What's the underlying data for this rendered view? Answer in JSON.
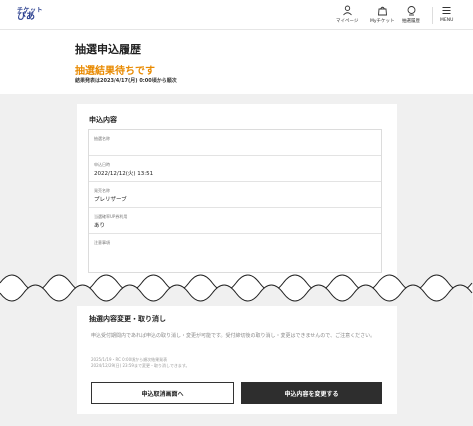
{
  "header": {
    "logo_line1": "チケット",
    "logo_line2": "ぴあ",
    "nav": [
      {
        "label": "マイページ",
        "icon": "person-icon"
      },
      {
        "label": "Myチケット",
        "icon": "ticket-bag-icon"
      },
      {
        "label": "抽選履歴",
        "icon": "search-history-icon"
      },
      {
        "label": "MENU",
        "icon": "menu-icon"
      }
    ]
  },
  "page": {
    "title": "抽選申込履歴",
    "status": "抽選結果待ちです",
    "announce_note": "結果発表は2023/4/17(月) 0:00頃から順次"
  },
  "details": {
    "section_title": "申込内容",
    "rows": [
      {
        "label": "抽選名称",
        "value": ""
      },
      {
        "label": "申込日時",
        "value": "2022/12/12(火) 13:51"
      },
      {
        "label": "発売名称",
        "value": "プレリザーブ"
      },
      {
        "label": "当選確率UP券利用",
        "value": "あり"
      },
      {
        "label": "注意事項",
        "value": ""
      }
    ]
  },
  "change": {
    "section_title": "抽選内容変更・取り消し",
    "paragraph": "申込受付期間内であれば申込の取り消し・変更が可能です。受付締切後の取り消し・変更はできませんので、ご注意ください。",
    "period_lines": [
      "2025/1/19・RC 0:00頃から順次結果発表",
      "2024/12/29(日) 23:59まで変更・取り消しできます。"
    ],
    "cancel_button": "申込取消画面へ",
    "change_button": "申込内容を変更する"
  },
  "colors": {
    "accent": "#e98a00",
    "brand": "#2a3f8f",
    "dark_button": "#2e2e2e",
    "background_grey": "#f0f0f0"
  }
}
